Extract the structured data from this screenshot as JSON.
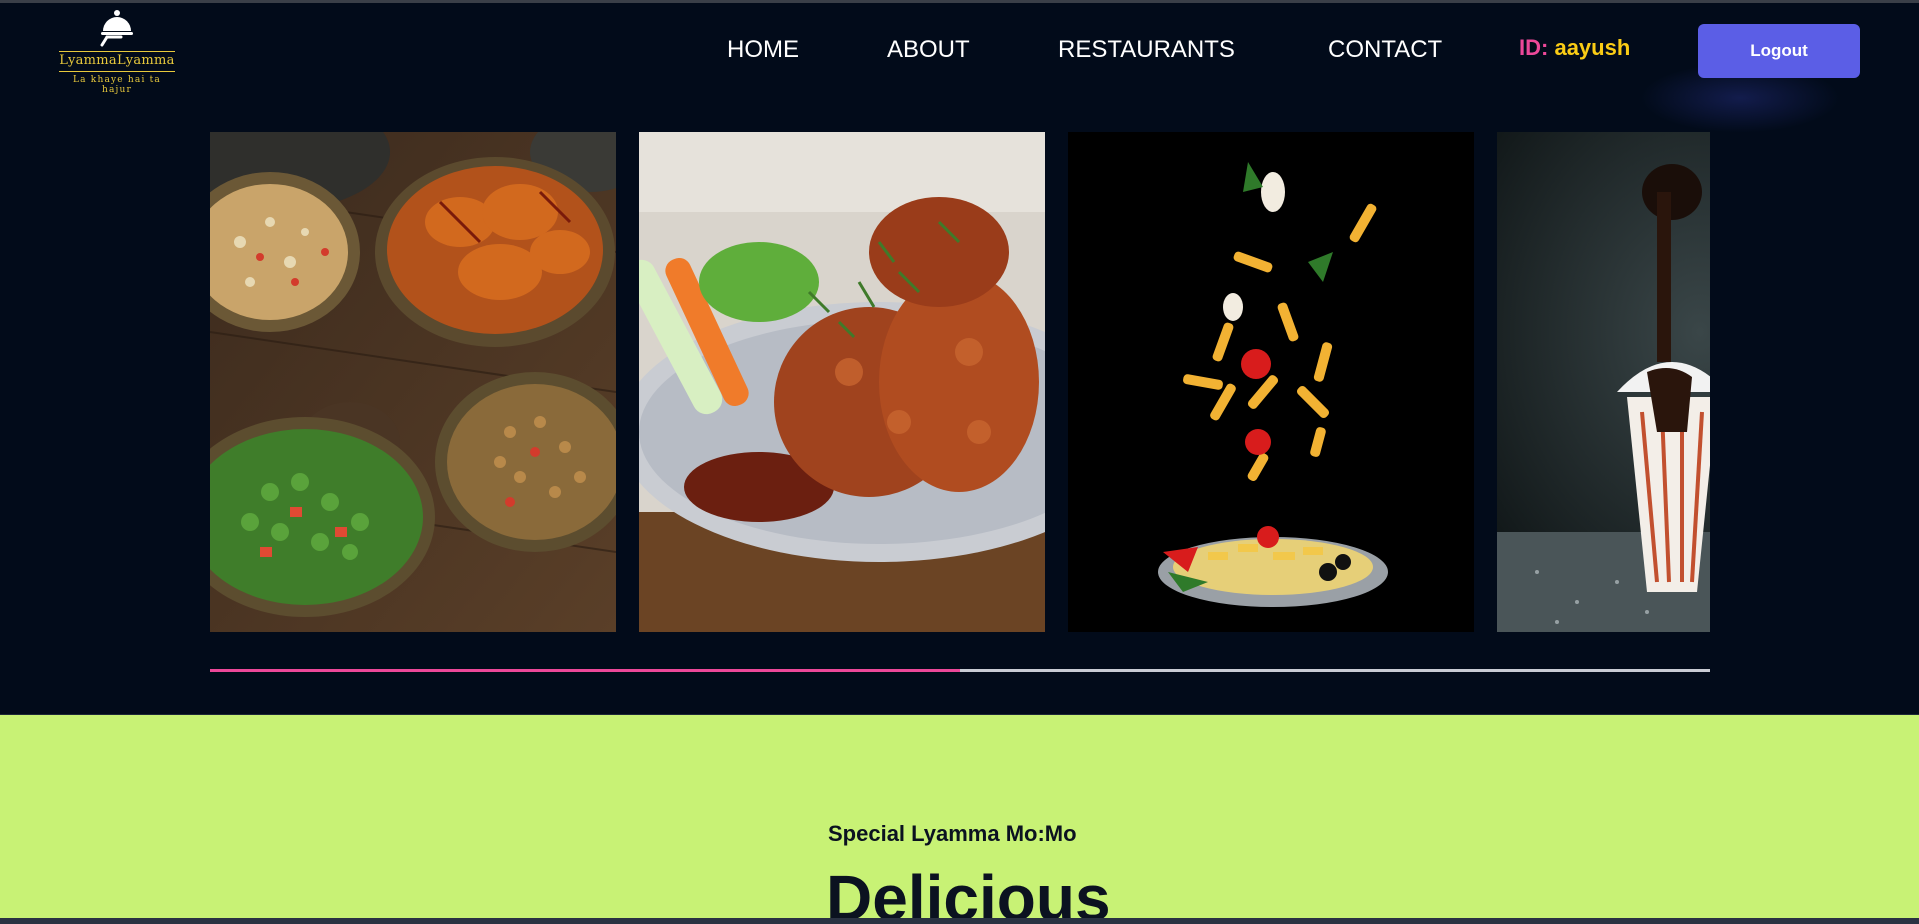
{
  "brand": {
    "name": "LyammaLyamma",
    "tagline": "La khaye hai ta hajur",
    "icon": "cloche-icon",
    "color": "#e8c93c"
  },
  "nav": {
    "items": [
      {
        "label": "HOME"
      },
      {
        "label": "ABOUT"
      },
      {
        "label": "RESTAURANTS"
      },
      {
        "label": "CONTACT"
      }
    ]
  },
  "user": {
    "id_label": "ID:",
    "id_value": "aayush"
  },
  "actions": {
    "logout_label": "Logout"
  },
  "carousel": {
    "slides": [
      {
        "name": "indian-snack-bowls"
      },
      {
        "name": "glazed-chicken-wings"
      },
      {
        "name": "falling-pasta-ingredients"
      },
      {
        "name": "chocolate-drizzle-dessert"
      }
    ],
    "next_icon": "arrow-right-icon",
    "progress_fraction": 0.5
  },
  "special": {
    "subtitle": "Special Lyamma Mo:Mo",
    "title": "Delicious"
  },
  "colors": {
    "background": "#020b1a",
    "accent": "#5b5ee6",
    "pink": "#ec4899",
    "yellow": "#facc15",
    "lime": "#c8f275"
  }
}
